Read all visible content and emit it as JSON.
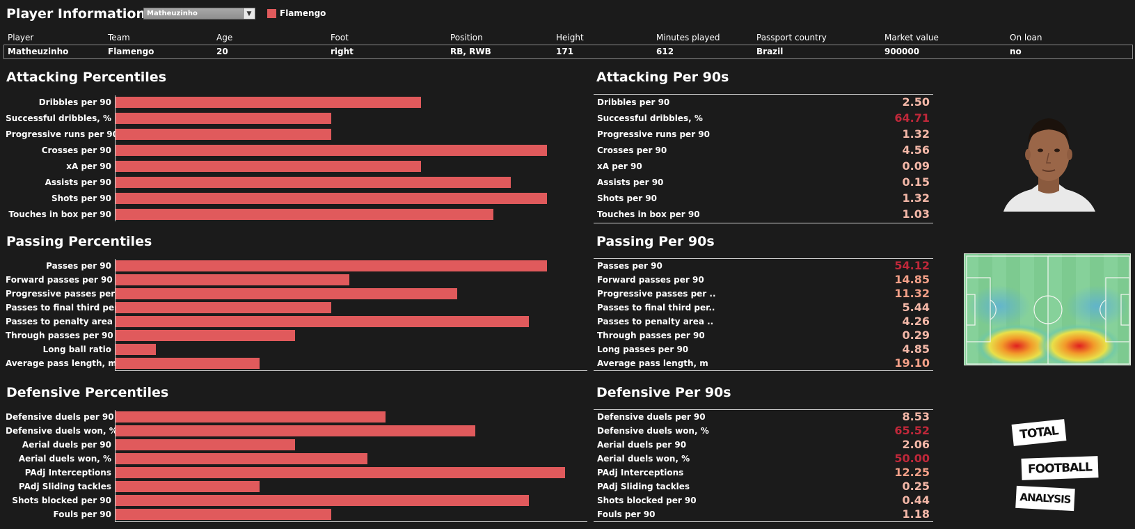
{
  "header": {
    "title": "Player Information",
    "selected_player": "Matheuzinho",
    "legend_label": "Flamengo",
    "legend_color": "#e05a5c"
  },
  "info_table": {
    "headers": [
      "Player",
      "Team",
      "Age",
      "Foot",
      "Position",
      "Height",
      "Minutes played",
      "Passport country",
      "Market value",
      "On loan"
    ],
    "values": [
      "Matheuzinho",
      "Flamengo",
      "20",
      "right",
      "RB, RWB",
      "171",
      "612",
      "Brazil",
      "900000",
      "no"
    ]
  },
  "attacking": {
    "title_percentiles": "Attacking Percentiles",
    "title_per90": "Attacking Per 90s",
    "rows": [
      {
        "label": "Dribbles per 90",
        "percentile": 0.68,
        "value": "2.50",
        "color": "#f4b8a8"
      },
      {
        "label": "Successful dribbles, %",
        "percentile": 0.48,
        "value": "64.71",
        "color": "#c0283a"
      },
      {
        "label": "Progressive runs per 90",
        "percentile": 0.48,
        "value": "1.32",
        "color": "#f4b8a8"
      },
      {
        "label": "Crosses per 90",
        "percentile": 0.96,
        "value": "4.56",
        "color": "#f4b8a8"
      },
      {
        "label": "xA per 90",
        "percentile": 0.68,
        "value": "0.09",
        "color": "#f4b8a8"
      },
      {
        "label": "Assists per 90",
        "percentile": 0.88,
        "value": "0.15",
        "color": "#f4b8a8"
      },
      {
        "label": "Shots per 90",
        "percentile": 0.96,
        "value": "1.32",
        "color": "#f4b8a8"
      },
      {
        "label": "Touches in box per 90",
        "percentile": 0.84,
        "value": "1.03",
        "color": "#f4b8a8"
      }
    ]
  },
  "passing": {
    "title_percentiles": "Passing Percentiles",
    "title_per90": "Passing Per 90s",
    "rows": [
      {
        "label": "Passes per 90",
        "percentile": 0.96,
        "value": "54.12",
        "color": "#c0283a"
      },
      {
        "label": "Forward passes per 90",
        "percentile": 0.52,
        "value": "14.85",
        "color": "#f4a088"
      },
      {
        "label": "Progressive passes per ..",
        "percentile": 0.76,
        "value": "11.32",
        "color": "#f4a088"
      },
      {
        "label": "Passes to final third per..",
        "percentile": 0.48,
        "value": "5.44",
        "color": "#f4b8a8"
      },
      {
        "label": "Passes to penalty area ..",
        "percentile": 0.92,
        "value": "4.26",
        "color": "#f4b8a8"
      },
      {
        "label": "Through passes per 90",
        "percentile": 0.4,
        "value": "0.29",
        "color": "#f4b8a8"
      },
      {
        "label": "Long ball ratio",
        "percentile": 0.09,
        "value": "4.85",
        "color": "#f4b8a8"
      },
      {
        "label": "Average pass length, m",
        "percentile": 0.32,
        "value": "19.10",
        "color": "#f4a088"
      }
    ],
    "extra_label_long_passes": "Long passes per 90"
  },
  "defensive": {
    "title_percentiles": "Defensive Percentiles",
    "title_per90": "Defensive Per 90s",
    "rows": [
      {
        "label": "Defensive duels per 90",
        "percentile": 0.6,
        "value": "8.53",
        "color": "#f4b8a8"
      },
      {
        "label": "Defensive duels won, %",
        "percentile": 0.8,
        "value": "65.52",
        "color": "#c0283a"
      },
      {
        "label": "Aerial duels per 90",
        "percentile": 0.4,
        "value": "2.06",
        "color": "#f4b8a8"
      },
      {
        "label": "Aerial duels won, %",
        "percentile": 0.56,
        "value": "50.00",
        "color": "#c0283a"
      },
      {
        "label": "PAdj Interceptions",
        "percentile": 1.0,
        "value": "12.25",
        "color": "#f4a088"
      },
      {
        "label": "PAdj Sliding tackles",
        "percentile": 0.32,
        "value": "0.25",
        "color": "#f4b8a8"
      },
      {
        "label": "Shots blocked per 90",
        "percentile": 0.92,
        "value": "0.44",
        "color": "#f4b8a8"
      },
      {
        "label": "Fouls per 90",
        "percentile": 0.48,
        "value": "1.18",
        "color": "#f4b8a8"
      }
    ]
  },
  "logo": {
    "line1": "TOTAL",
    "line2": "FOOTBALL",
    "line3": "ANALYSIS"
  }
}
